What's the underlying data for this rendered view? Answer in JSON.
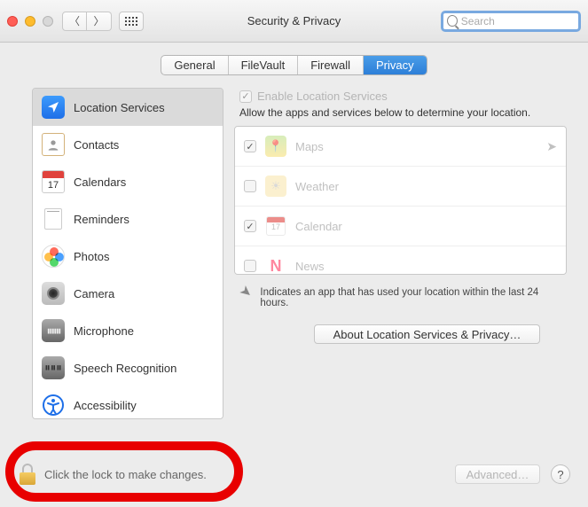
{
  "window": {
    "title": "Security & Privacy"
  },
  "search": {
    "placeholder": "Search"
  },
  "tabs": {
    "general": "General",
    "filevault": "FileVault",
    "firewall": "Firewall",
    "privacy": "Privacy"
  },
  "sidebar": {
    "location": "Location Services",
    "contacts": "Contacts",
    "calendars": "Calendars",
    "cal_day": "17",
    "reminders": "Reminders",
    "photos": "Photos",
    "camera": "Camera",
    "microphone": "Microphone",
    "speech": "Speech Recognition",
    "accessibility": "Accessibility"
  },
  "panel": {
    "enable": "Enable Location Services",
    "allow": "Allow the apps and services below to determine your location.",
    "apps": {
      "maps": "Maps",
      "weather": "Weather",
      "calendar": "Calendar",
      "news": "News"
    },
    "indicates": "Indicates an app that has used your location within the last 24 hours.",
    "about": "About Location Services & Privacy…"
  },
  "footer": {
    "lock": "Click the lock to make changes.",
    "advanced": "Advanced…",
    "help": "?"
  }
}
